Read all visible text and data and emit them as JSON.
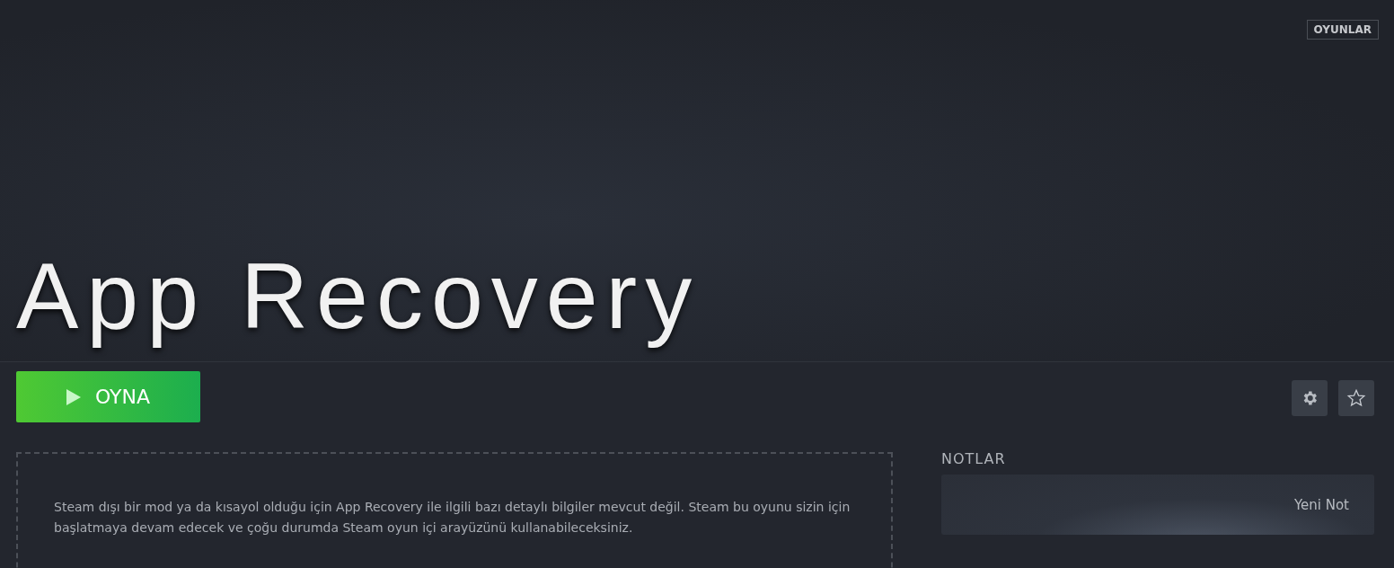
{
  "header": {
    "badge": "OYUNLAR",
    "title": "App Recovery"
  },
  "play_button": {
    "label": "OYNA"
  },
  "info": {
    "text": "Steam dışı bir mod ya da kısayol olduğu için App Recovery ile ilgili bazı detaylı bilgiler mevcut değil. Steam bu oyunu sizin için başlatmaya devam edecek ve çoğu durumda Steam oyun içi arayüzünü kullanabileceksiniz."
  },
  "notes": {
    "heading": "NOTLAR",
    "new_note": "Yeni Not"
  }
}
